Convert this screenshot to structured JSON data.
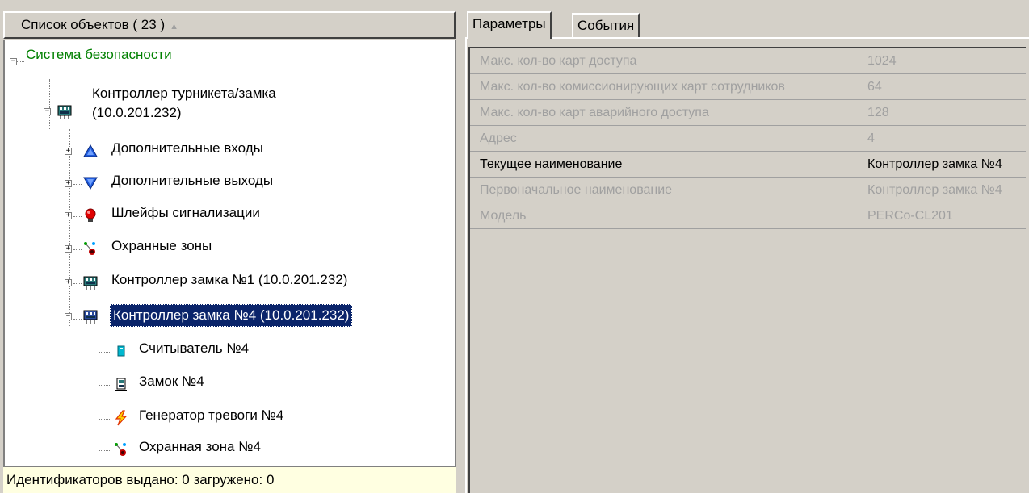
{
  "left": {
    "header": {
      "title": "Список объектов ( 23 )",
      "sort_glyph": "▲"
    },
    "tree": {
      "root": "Система безопасности",
      "controller": {
        "line1": "Контроллер турникета/замка",
        "line2": "(10.0.201.232)"
      },
      "children": [
        "Дополнительные входы",
        "Дополнительные выходы",
        "Шлейфы сигнализации",
        "Охранные зоны",
        "Контроллер замка №1 (10.0.201.232)",
        "Контроллер замка №4 (10.0.201.232)"
      ],
      "grandchildren": [
        "Считыватель №4",
        "Замок №4",
        "Генератор тревоги №4",
        "Охранная зона №4"
      ],
      "expander_collapsed": "+",
      "expander_expanded": "−"
    },
    "status": "Идентификаторов выдано: 0 загружено: 0"
  },
  "right": {
    "tabs": [
      {
        "label": "Параметры",
        "active": true
      },
      {
        "label": "События",
        "active": false
      }
    ],
    "properties": [
      {
        "name": "Макс. кол-во карт доступа",
        "value": "1024",
        "enabled": false
      },
      {
        "name": "Макс. кол-во комиссионирующих карт сотрудников",
        "value": "64",
        "enabled": false
      },
      {
        "name": "Макс. кол-во карт аварийного доступа",
        "value": "128",
        "enabled": false
      },
      {
        "name": "Адрес",
        "value": "4",
        "enabled": false
      },
      {
        "name": "Текущее наименование",
        "value": "Контроллер замка №4",
        "enabled": true
      },
      {
        "name": "Первоначальное наименование",
        "value": "Контроллер замка №4",
        "enabled": false
      },
      {
        "name": "Модель",
        "value": "PERCo-CL201",
        "enabled": false
      }
    ]
  },
  "icons": {
    "root": "none",
    "controller": "controller-board-icon",
    "children": [
      "input-triangle-blue-icon",
      "output-triangle-blue-icon",
      "alarm-lamp-red-icon",
      "security-zone-icon",
      "lock-controller-icon",
      "lock-controller-icon"
    ],
    "grandchildren": [
      "reader-icon",
      "lock-icon",
      "alarm-generator-icon",
      "security-zone-icon"
    ]
  },
  "colors": {
    "selection": "#0a246a",
    "root_text": "#008000",
    "status_bg": "#ffffe1",
    "disabled_text": "#a0a0a0"
  }
}
